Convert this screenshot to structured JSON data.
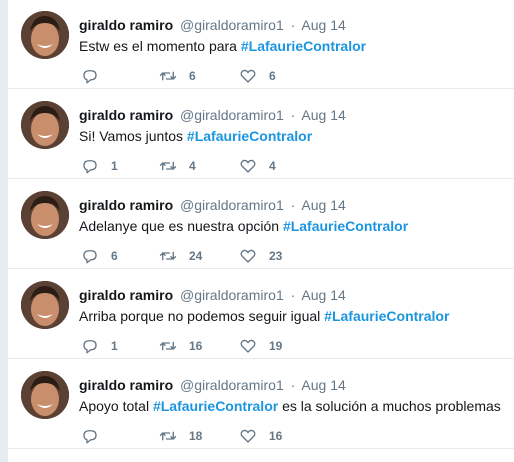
{
  "tweets": [
    {
      "name": "giraldo ramiro",
      "handle": "@giraldoramiro1",
      "separator": "·",
      "date": "Aug 14",
      "text_before": "Estw es el momento para",
      "hashtag": "#LafaurieContralor",
      "text_after": "",
      "reply_count": "",
      "retweet_count": "6",
      "like_count": "6"
    },
    {
      "name": "giraldo ramiro",
      "handle": "@giraldoramiro1",
      "separator": "·",
      "date": "Aug 14",
      "text_before": "Si! Vamos juntos",
      "hashtag": "#LafaurieContralor",
      "text_after": "",
      "reply_count": "1",
      "retweet_count": "4",
      "like_count": "4"
    },
    {
      "name": "giraldo ramiro",
      "handle": "@giraldoramiro1",
      "separator": "·",
      "date": "Aug 14",
      "text_before": "Adelanye que es nuestra opción",
      "hashtag": "#LafaurieContralor",
      "text_after": "",
      "reply_count": "6",
      "retweet_count": "24",
      "like_count": "23"
    },
    {
      "name": "giraldo ramiro",
      "handle": "@giraldoramiro1",
      "separator": "·",
      "date": "Aug 14",
      "text_before": "Arriba porque no podemos seguir igual",
      "hashtag": "#LafaurieContralor",
      "text_after": "",
      "reply_count": "1",
      "retweet_count": "16",
      "like_count": "19"
    },
    {
      "name": "giraldo ramiro",
      "handle": "@giraldoramiro1",
      "separator": "·",
      "date": "Aug 14",
      "text_before": "Apoyo total",
      "hashtag": "#LafaurieContralor",
      "text_after": "es la solución a muchos problemas",
      "reply_count": "",
      "retweet_count": "18",
      "like_count": "16"
    }
  ],
  "icons": {
    "reply": "reply-icon",
    "retweet": "retweet-icon",
    "like": "heart-icon"
  },
  "colors": {
    "hashtag": "#1b95e0",
    "secondary_text": "#657786",
    "primary_text": "#14171a"
  }
}
